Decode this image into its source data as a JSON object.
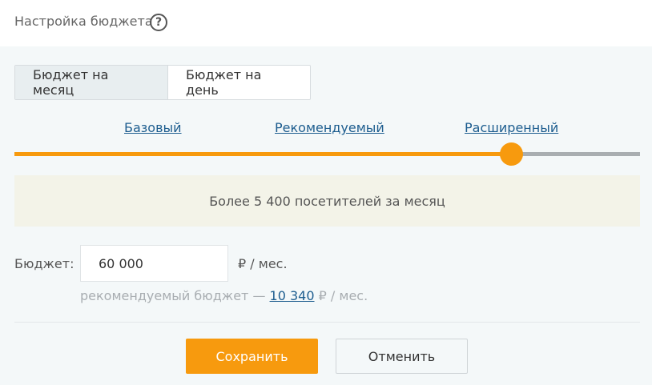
{
  "header": {
    "title": "Настройка бюджета",
    "help_icon": "question-circle-icon",
    "help_symbol": "?"
  },
  "tabs": [
    {
      "label": "Бюджет на месяц",
      "active": true
    },
    {
      "label": "Бюджет на день",
      "active": false
    }
  ],
  "levels": {
    "basic": "Базовый",
    "recommended": "Рекомендуемый",
    "extended": "Расширенный",
    "selected": "Расширенный",
    "slider_value": 0.795
  },
  "info": {
    "text": "Более 5 400 посетителей за месяц"
  },
  "budget": {
    "label": "Бюджет:",
    "value": "60 000",
    "unit": "₽ / мес.",
    "reco_prefix": "рекомендуемый бюджет —",
    "reco_value": "10 340",
    "reco_suffix": "₽ / мес."
  },
  "actions": {
    "save": "Сохранить",
    "cancel": "Отменить"
  },
  "colors": {
    "accent": "#f79a0e",
    "link": "#1d5d8f",
    "panel_bg": "#f4f8f9",
    "info_bg": "#f3f3e8"
  }
}
